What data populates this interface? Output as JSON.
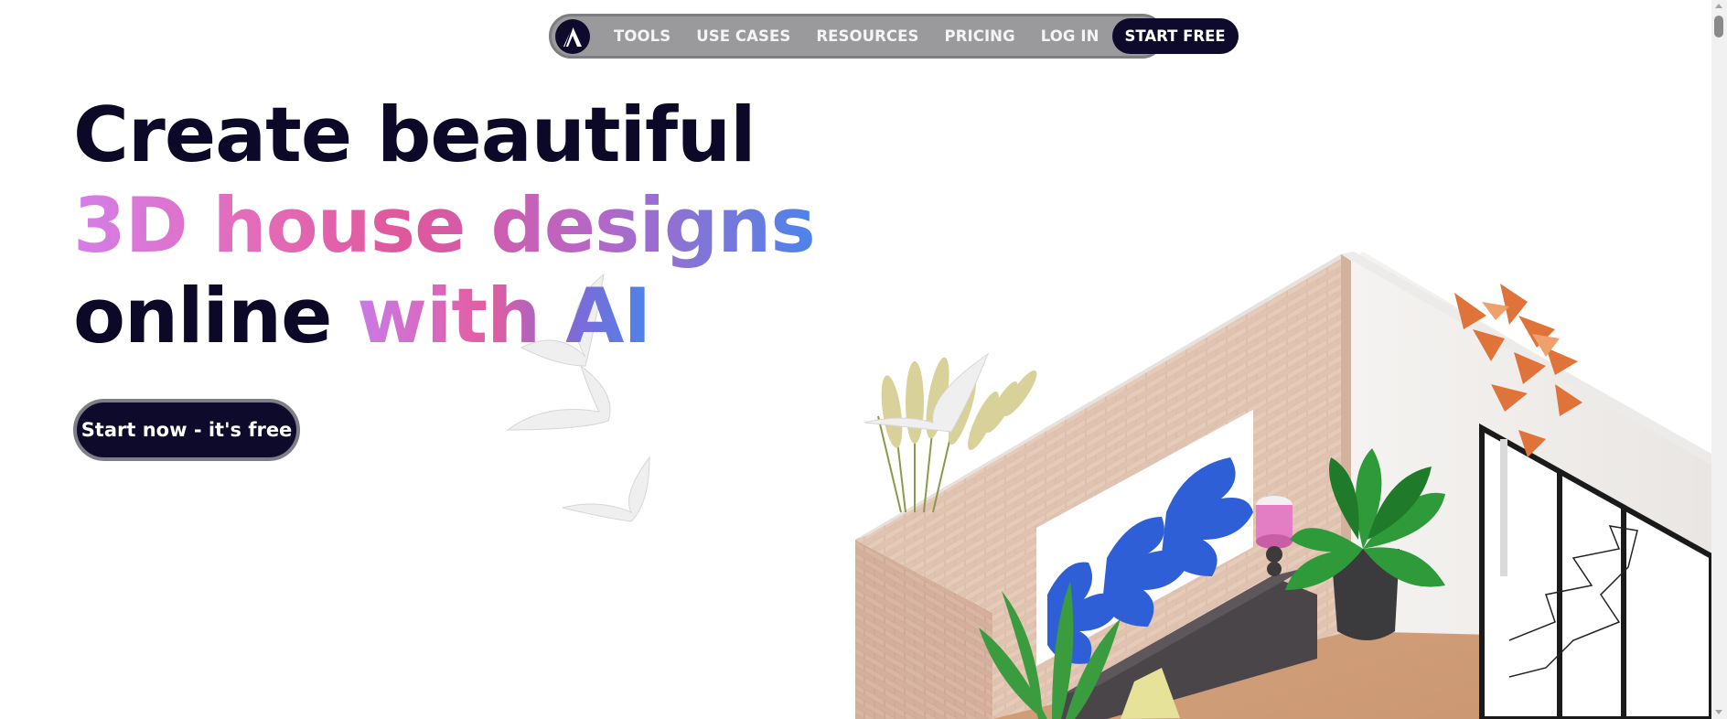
{
  "nav": {
    "logo_alt": "A",
    "items": [
      {
        "label": "TOOLS"
      },
      {
        "label": "USE CASES"
      },
      {
        "label": "RESOURCES"
      },
      {
        "label": "PRICING"
      },
      {
        "label": "LOG IN"
      }
    ],
    "cta_label": "START FREE"
  },
  "hero": {
    "line1": "Create beautiful",
    "line2": "3D house designs",
    "line3_plain": "online ",
    "line3_gradient": "with AI",
    "cta_label": "Start now - it's free"
  },
  "icons": {
    "logo": "a-logo-icon",
    "illustration": "isometric-room-illustration"
  },
  "colors": {
    "brand_navy": "#0d0a2b",
    "nav_background": "#9a9a9c",
    "gradient_pink": "#e0579b",
    "gradient_violet": "#d47ee8",
    "gradient_blue": "#4b84ea"
  }
}
